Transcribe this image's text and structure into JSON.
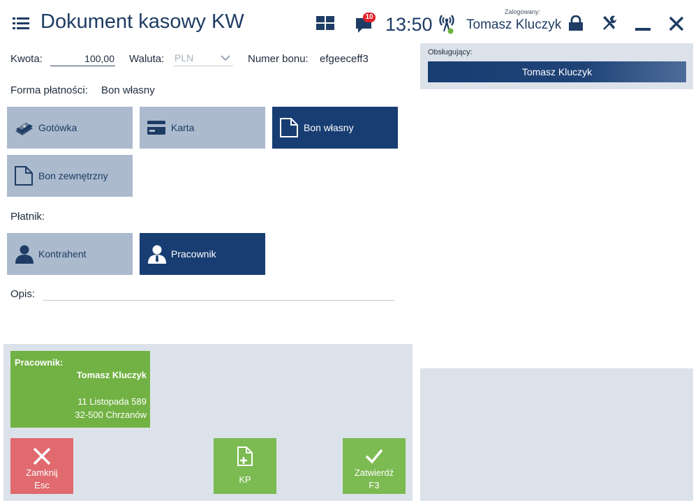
{
  "header": {
    "title": "Dokument kasowy KW",
    "notifications_count": "10",
    "time": "13:50",
    "logged_label": "Zalogowany:",
    "logged_user": "Tomasz Kluczyk"
  },
  "form": {
    "kwota_label": "Kwota:",
    "kwota_value": "100,00",
    "waluta_label": "Waluta:",
    "waluta_value": "PLN",
    "numer_bonu_label": "Numer bonu:",
    "numer_bonu_value": "efgeeceff3",
    "forma_label": "Forma płatności:",
    "forma_value": "Bon własny",
    "platnik_label": "Płatnik:",
    "opis_label": "Opis:",
    "opis_value": ""
  },
  "payment_methods": [
    {
      "label": "Gotówka",
      "icon": "cash-icon",
      "active": false
    },
    {
      "label": "Karta",
      "icon": "card-icon",
      "active": false
    },
    {
      "label": "Bon własny",
      "icon": "document-icon",
      "active": true
    },
    {
      "label": "Bon zewnętrzny",
      "icon": "document-icon",
      "active": false
    }
  ],
  "payers": [
    {
      "label": "Kontrahent",
      "icon": "person-icon",
      "active": false
    },
    {
      "label": "Pracownik",
      "icon": "employee-icon",
      "active": true
    }
  ],
  "service": {
    "label": "Obsługujący:",
    "name": "Tomasz Kluczyk"
  },
  "payer_card": {
    "title": "Pracownik:",
    "name": "Tomasz Kluczyk",
    "address1": "11 Listopada 589",
    "address2": "32-500 Chrzanów"
  },
  "actions": {
    "close_label": "Zamknij",
    "close_key": "Esc",
    "kp_label": "KP",
    "confirm_label": "Zatwierdź",
    "confirm_key": "F3"
  },
  "colors": {
    "accent": "#183d72",
    "tile": "#abbacd",
    "panel": "#dce2ea",
    "green": "#7cba52",
    "red": "#e06a6e"
  }
}
